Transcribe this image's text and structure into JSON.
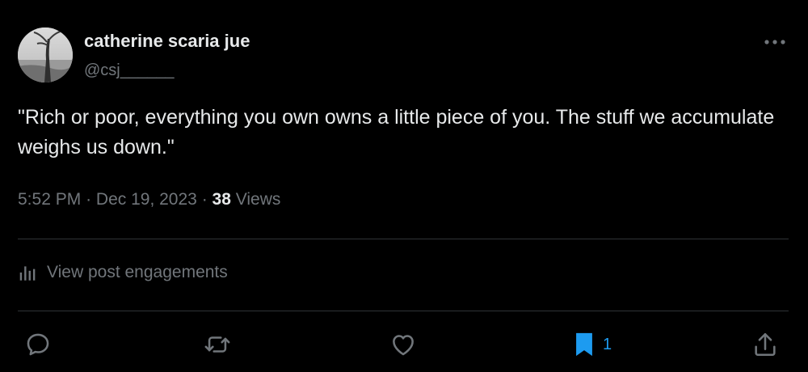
{
  "author": {
    "display_name": "catherine scaria jue",
    "handle": "@csj______"
  },
  "post": {
    "text": "\"Rich or poor, everything you own owns a little piece of you. The stuff we accumulate weighs us down.\"",
    "time": "5:52 PM",
    "separator": "·",
    "date": "Dec 19, 2023",
    "views_count": "38",
    "views_label": "Views"
  },
  "engagements": {
    "label": "View post engagements",
    "icon": "analytics-icon"
  },
  "actions": {
    "reply_icon": "reply-icon",
    "repost_icon": "repost-icon",
    "like_icon": "like-icon",
    "bookmark_icon": "bookmark-icon",
    "bookmark_count": "1",
    "share_icon": "share-icon",
    "more_icon": "more-icon"
  },
  "colors": {
    "background": "#000000",
    "text_primary": "#e7e9ea",
    "text_secondary": "#71767b",
    "divider": "#2f3336",
    "accent_blue": "#1d9bf0"
  }
}
